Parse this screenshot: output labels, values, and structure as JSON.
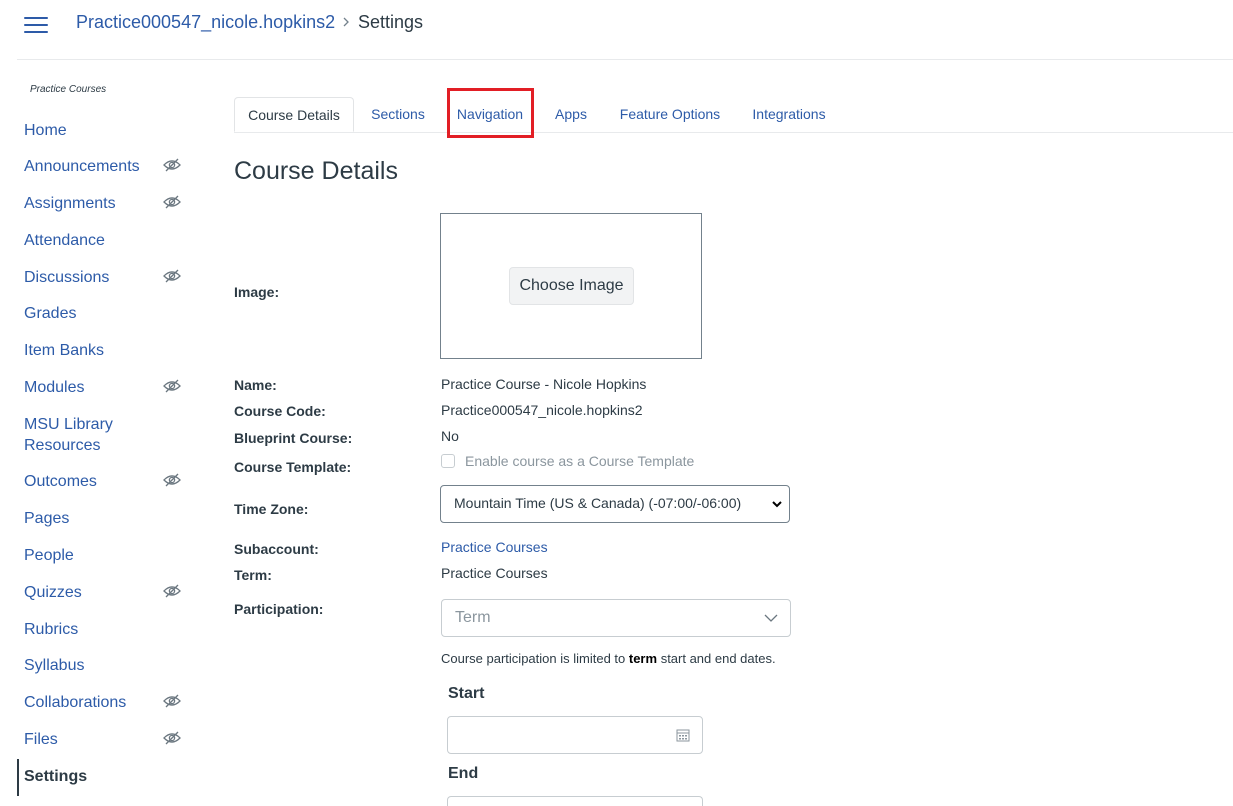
{
  "breadcrumb": {
    "course": "Practice000547_nicole.hopkins2",
    "current": "Settings"
  },
  "sidebar": {
    "course_label": "Practice Courses",
    "items": [
      {
        "label": "Home",
        "hidden": false
      },
      {
        "label": "Announcements",
        "hidden": true
      },
      {
        "label": "Assignments",
        "hidden": true
      },
      {
        "label": "Attendance",
        "hidden": false
      },
      {
        "label": "Discussions",
        "hidden": true
      },
      {
        "label": "Grades",
        "hidden": false
      },
      {
        "label": "Item Banks",
        "hidden": false
      },
      {
        "label": "Modules",
        "hidden": true
      },
      {
        "label": "MSU Library",
        "label2": "Resources",
        "hidden": false
      },
      {
        "label": "Outcomes",
        "hidden": true
      },
      {
        "label": "Pages",
        "hidden": false
      },
      {
        "label": "People",
        "hidden": false
      },
      {
        "label": "Quizzes",
        "hidden": true
      },
      {
        "label": "Rubrics",
        "hidden": false
      },
      {
        "label": "Syllabus",
        "hidden": false
      },
      {
        "label": "Collaborations",
        "hidden": true
      },
      {
        "label": "Files",
        "hidden": true
      },
      {
        "label": "Settings",
        "hidden": false,
        "active": true
      }
    ]
  },
  "tabs": [
    {
      "label": "Course Details",
      "active": true
    },
    {
      "label": "Sections"
    },
    {
      "label": "Navigation",
      "highlighted": true
    },
    {
      "label": "Apps"
    },
    {
      "label": "Feature Options"
    },
    {
      "label": "Integrations"
    }
  ],
  "page_title": "Course Details",
  "form": {
    "image_label": "Image:",
    "choose_image": "Choose Image",
    "name_label": "Name:",
    "name_value": "Practice Course - Nicole Hopkins",
    "code_label": "Course Code:",
    "code_value": "Practice000547_nicole.hopkins2",
    "blueprint_label": "Blueprint Course:",
    "blueprint_value": "No",
    "template_label": "Course Template:",
    "template_checkbox": "Enable course as a Course Template",
    "timezone_label": "Time Zone:",
    "timezone_value": "Mountain Time (US & Canada) (-07:00/-06:00)",
    "subaccount_label": "Subaccount:",
    "subaccount_value": "Practice Courses",
    "term_label": "Term:",
    "term_value": "Practice Courses",
    "participation_label": "Participation:",
    "participation_value": "Term",
    "participation_note_pre": "Course participation is limited to",
    "participation_note_bold": "term",
    "participation_note_post": "start and end dates.",
    "start_label": "Start",
    "end_label": "End"
  },
  "colors": {
    "link": "#2d5ba8",
    "text": "#2d3b45",
    "highlight": "#e21e25"
  }
}
